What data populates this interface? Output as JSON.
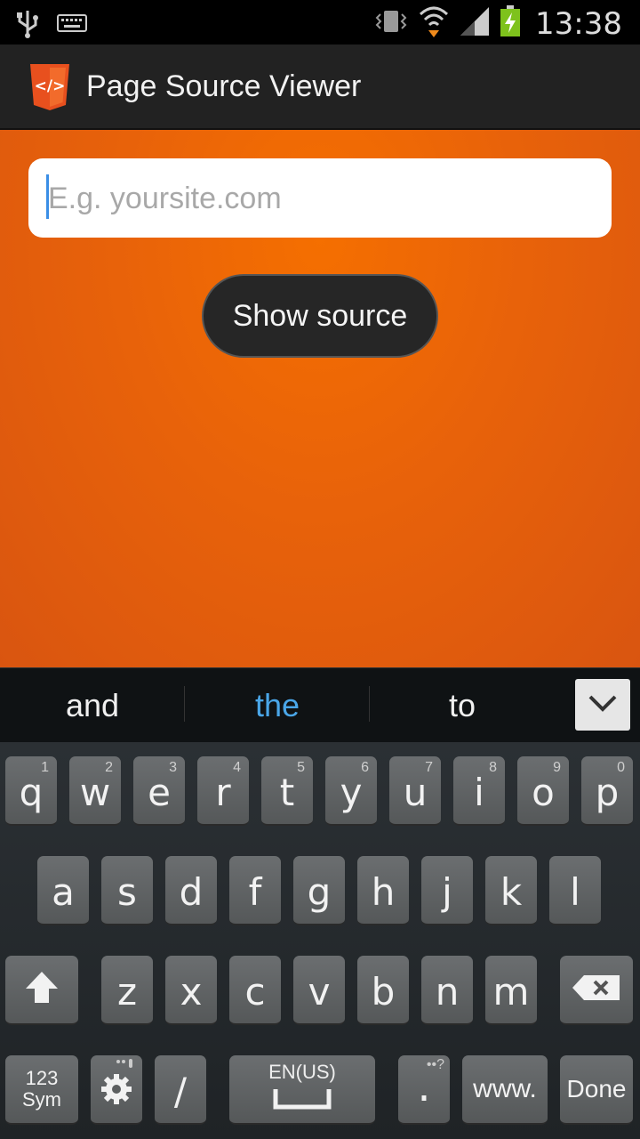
{
  "status_bar": {
    "time": "13:38",
    "left_icons": [
      "usb-icon",
      "keyboard-icon"
    ],
    "right_icons": [
      "vibrate-icon",
      "wifi-icon",
      "signal-icon",
      "battery-charging-icon"
    ]
  },
  "action_bar": {
    "title": "Page Source Viewer",
    "logo_text": "</>"
  },
  "form": {
    "url_placeholder": "E.g. yoursite.com",
    "url_value": "",
    "show_button": "Show source"
  },
  "suggestions": [
    "and",
    "the",
    "to"
  ],
  "keyboard": {
    "row1": [
      {
        "ch": "q",
        "num": "1"
      },
      {
        "ch": "w",
        "num": "2"
      },
      {
        "ch": "e",
        "num": "3"
      },
      {
        "ch": "r",
        "num": "4"
      },
      {
        "ch": "t",
        "num": "5"
      },
      {
        "ch": "y",
        "num": "6"
      },
      {
        "ch": "u",
        "num": "7"
      },
      {
        "ch": "i",
        "num": "8"
      },
      {
        "ch": "o",
        "num": "9"
      },
      {
        "ch": "p",
        "num": "0"
      }
    ],
    "row2": [
      "a",
      "s",
      "d",
      "f",
      "g",
      "h",
      "j",
      "k",
      "l"
    ],
    "row3": [
      "z",
      "x",
      "c",
      "v",
      "b",
      "n",
      "m"
    ],
    "sym_label_1": "123",
    "sym_label_2": "Sym",
    "slash": "/",
    "space_label": "EN(US)",
    "period": ".",
    "period_hint": "••?",
    "www": "www.",
    "done": "Done"
  },
  "colors": {
    "accent_orange": "#f56f00",
    "suggestion_highlight": "#4aa6e8"
  }
}
